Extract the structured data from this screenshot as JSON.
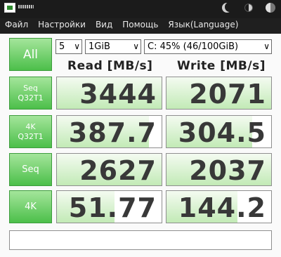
{
  "window": {
    "icons": [
      "app-icon",
      "moon-icon",
      "half-circle-icon",
      "contrast-icon"
    ]
  },
  "menu": {
    "items": [
      "Файл",
      "Настройки",
      "Вид",
      "Помощь",
      "Язык(Language)"
    ]
  },
  "toolbar": {
    "all_label": "All",
    "test_count": "5",
    "test_size": "1GiB",
    "drive": "C: 45% (46/100GiB)"
  },
  "columns": {
    "read": "Read [MB/s]",
    "write": "Write [MB/s]"
  },
  "rows": [
    {
      "label_1": "Seq",
      "label_2": "Q32T1",
      "read": "3444",
      "write": "2071",
      "read_fill": 1.0,
      "write_fill": 1.0
    },
    {
      "label_1": "4K",
      "label_2": "Q32T1",
      "read": "387.7",
      "write": "304.5",
      "read_fill": 0.88,
      "write_fill": 0.82
    },
    {
      "label_1": "Seq",
      "label_2": "",
      "read": "2627",
      "write": "2037",
      "read_fill": 1.0,
      "write_fill": 1.0
    },
    {
      "label_1": "4K",
      "label_2": "",
      "read": "51.77",
      "write": "144.2",
      "read_fill": 0.55,
      "write_fill": 0.68
    }
  ],
  "colors": {
    "accent_green": "#4cbf4a",
    "bar_light": "#c2eab6"
  }
}
